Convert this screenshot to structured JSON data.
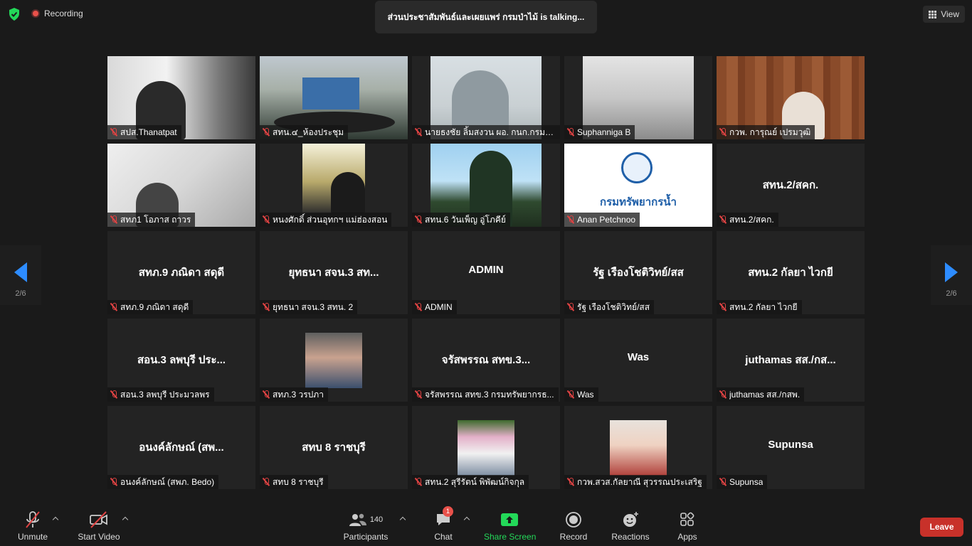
{
  "topbar": {
    "recording_label": "Recording",
    "talking_text": "ส่วนประชาสัมพันธ์และเผยแพร่ กรมป่าไม้ is  talking...",
    "view_label": "View"
  },
  "pager": {
    "left_page": "2/6",
    "right_page": "2/6"
  },
  "tiles": [
    {
      "label": "สปส.Thanatpat",
      "center": ""
    },
    {
      "label": "สทน.๔_ห้องประชุม",
      "center": ""
    },
    {
      "label": "นายธงชัย ลิ้มสงวน ผอ. กนก.กรมท...",
      "center": ""
    },
    {
      "label": "Suphanniga B",
      "center": ""
    },
    {
      "label": "กวพ. การุณย์ เปรมวุฒิ",
      "center": ""
    },
    {
      "label": "สทภ1 โอภาส ถาวร",
      "center": ""
    },
    {
      "label": "หนงศักดิ์ ส่วนอุทกฯ แม่ฮ่องสอน",
      "center": ""
    },
    {
      "label": "สทน.6 วันเพ็ญ อู่โภคีย์",
      "center": ""
    },
    {
      "label": "Anan Petchnoo",
      "center": "",
      "logo_text": "กรมทรัพยากรน้ำ"
    },
    {
      "label": "สทน.2/สคก.",
      "center": "สทน.2/สคก."
    },
    {
      "label": "สทภ.9 ภณิดา สดุดี",
      "center": "สทภ.9 ภณิดา สดุดี"
    },
    {
      "label": "ยุทธนา สจน.3 สทน. 2",
      "center": "ยุทธนา สจน.3 สท..."
    },
    {
      "label": "ADMIN",
      "center": "ADMIN"
    },
    {
      "label": "รัฐ เรืองโชติวิทย์/สส",
      "center": "รัฐ เรืองโชติวิทย์/สส"
    },
    {
      "label": "สทน.2 กัลยา ไวกยี",
      "center": "สทน.2 กัลยา ไวกยี"
    },
    {
      "label": "สอน.3 ลพบุรี ประมวลพร",
      "center": "สอน.3 ลพบุรี ประ..."
    },
    {
      "label": "สทภ.3 วรปภา",
      "center": ""
    },
    {
      "label": "จรัสพรรณ สทข.3 กรมทรัพยากรธ...",
      "center": "จรัสพรรณ สทข.3..."
    },
    {
      "label": "Was",
      "center": "Was"
    },
    {
      "label": "juthamas สส./กสพ.",
      "center": "juthamas สส./กส..."
    },
    {
      "label": "อนงค์ลักษณ์ (สพภ. Bedo)",
      "center": "อนงค์ลักษณ์ (สพ..."
    },
    {
      "label": "สทบ 8 ราชบุรี",
      "center": "สทบ 8 ราชบุรี"
    },
    {
      "label": "สทน.2 สุรีรัตน์ พิพัฒน์กิจกุล",
      "center": ""
    },
    {
      "label": "กวพ.สวส.กัลยาณี สุวรรณประเสริฐ",
      "center": ""
    },
    {
      "label": "Supunsa",
      "center": "Supunsa"
    }
  ],
  "toolbar": {
    "unmute": "Unmute",
    "start_video": "Start Video",
    "participants": "Participants",
    "participants_count": "140",
    "chat": "Chat",
    "chat_badge": "1",
    "share_screen": "Share Screen",
    "record": "Record",
    "reactions": "Reactions",
    "apps": "Apps",
    "leave": "Leave"
  },
  "colors": {
    "accent": "#2d8cff",
    "share_green": "#23d959",
    "leave_red": "#c8312a",
    "muted_red": "#e04343"
  }
}
